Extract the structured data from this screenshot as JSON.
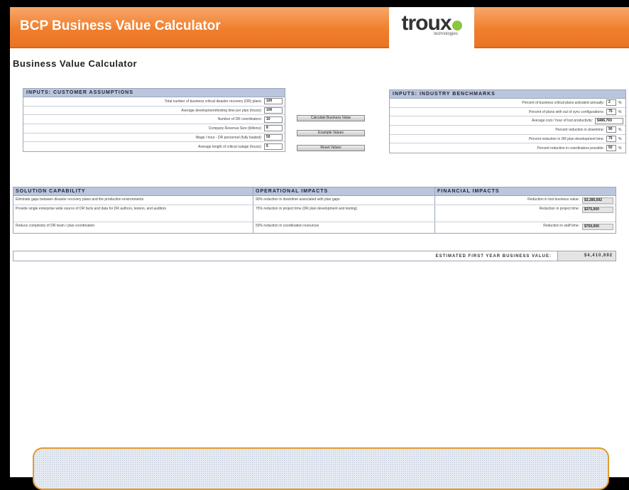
{
  "header": {
    "title": "BCP Business Value Calculator",
    "logo_word": "troux",
    "logo_sub": "technologies"
  },
  "page_title": "Business Value Calculator",
  "customer": {
    "heading": "INPUTS: CUSTOMER ASSUMPTIONS",
    "rows": [
      {
        "label": "Total number of business critical disaster recovery (DR) plans:",
        "value": "100"
      },
      {
        "label": "Average development/testing time per plan (hours):",
        "value": "100"
      },
      {
        "label": "Number of DR coordinators:",
        "value": "10"
      },
      {
        "label": "Company Revenue Size (billions):",
        "value": "8"
      },
      {
        "label": "Wage / hour - DR personnel (fully loaded):",
        "value": "50"
      },
      {
        "label": "Average length of critical outage (hours):",
        "value": "6"
      }
    ]
  },
  "buttons": {
    "calculate": "Calculate Business Value",
    "example": "Example Values",
    "reset": "Reset Values"
  },
  "industry": {
    "heading": "INPUTS: INDUSTRY BENCHMARKS",
    "rows": [
      {
        "label": "Percent of business critical plans activated annually:",
        "value": "2",
        "unit": "%"
      },
      {
        "label": "Percent of plans with out of sync configurations:",
        "value": "75",
        "unit": "%"
      },
      {
        "label": "Average cost / hour of lost productivity:",
        "value": "$486,769",
        "unit": ""
      },
      {
        "label": "Percent reduction in downtime:",
        "value": "90",
        "unit": "%"
      },
      {
        "label": "Percent reduction in DR plan development time:",
        "value": "75",
        "unit": "%"
      },
      {
        "label": "Percent reduction in coordinators possible:",
        "value": "50",
        "unit": "%"
      }
    ]
  },
  "solution": {
    "headings": {
      "capability": "SOLUTION CAPABILITY",
      "operational": "OPERATIONAL IMPACTS",
      "financial": "FINANCIAL IMPACTS"
    },
    "rows": [
      {
        "capability": "Eliminate gaps between disaster recovery plans and the production environments",
        "operational": "90% reduction in downtime associated with plan gaps",
        "financial_label": "Reduction in lost business value:",
        "financial_value": "$3,285,692"
      },
      {
        "capability": "Provide single enterprise wide source of DR facts and data for DR authors, testers, and auditors",
        "operational": "75% reduction in project time (DR plan development and testing)",
        "financial_label": "Reduction in project time:",
        "financial_value": "$375,000"
      },
      {
        "capability": "Reduce complexity of DR team / plan coordination",
        "operational": "50% reduction in coordination resources",
        "financial_label": "Reduction in staff time:",
        "financial_value": "$750,000"
      }
    ]
  },
  "total": {
    "label": "ESTIMATED FIRST YEAR BUSINESS VALUE:",
    "value": "$4,410,692"
  }
}
